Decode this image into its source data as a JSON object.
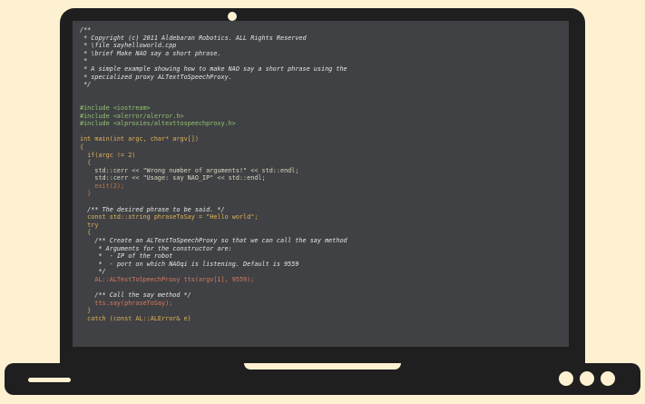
{
  "code_lines": [
    {
      "cls": "c",
      "text": "/**"
    },
    {
      "cls": "c",
      "text": " * Copyright (c) 2011 Aldebaran Robotics. ALL Rights Reserved"
    },
    {
      "cls": "c",
      "text": " * \\file sayhelloworld.cpp"
    },
    {
      "cls": "c",
      "text": " * \\brief Make NAO say a short phrase."
    },
    {
      "cls": "c",
      "text": " *"
    },
    {
      "cls": "c",
      "text": " * A simple example showing how to make NAO say a short phrase using the"
    },
    {
      "cls": "c",
      "text": " * specialized proxy ALTextToSpeechProxy."
    },
    {
      "cls": "c",
      "text": " */"
    },
    {
      "cls": "tx",
      "text": ""
    },
    {
      "cls": "tx",
      "text": ""
    },
    {
      "cls": "pp",
      "text": "#include <iostream>"
    },
    {
      "cls": "pp",
      "text": "#include <alerror/alerror.h>"
    },
    {
      "cls": "pp",
      "text": "#include <alproxies/altexttospeechproxy.h>"
    },
    {
      "cls": "tx",
      "text": ""
    },
    {
      "cls": "kw",
      "text": "int main(int argc, char* argv[])"
    },
    {
      "cls": "kw",
      "text": "{"
    },
    {
      "cls": "kw",
      "text": "  if(argc != 2)"
    },
    {
      "cls": "kw",
      "text": "  {"
    },
    {
      "cls": "st",
      "text": "    std::cerr << \"Wrong number of arguments!\" << std::endl;"
    },
    {
      "cls": "st",
      "text": "    std::cerr << \"Usage: say NAO_IP\" << std::endl;"
    },
    {
      "cls": "fn",
      "text": "    exit(2);"
    },
    {
      "cls": "fn",
      "text": "  }"
    },
    {
      "cls": "tx",
      "text": ""
    },
    {
      "cls": "c",
      "text": "  /** The desired phrase to be said. */"
    },
    {
      "cls": "kw",
      "text": "  const std::string phraseToSay = \"Hello world\";"
    },
    {
      "cls": "kw",
      "text": "  try"
    },
    {
      "cls": "kw",
      "text": "  {"
    },
    {
      "cls": "c",
      "text": "    /** Create an ALTextToSpeechProxy so that we can call the say method"
    },
    {
      "cls": "c",
      "text": "     * Arguments for the constructor are:"
    },
    {
      "cls": "c",
      "text": "     *  - IP of the robot"
    },
    {
      "cls": "c",
      "text": "     *  - port on which NAOqi is listening. Default is 9559"
    },
    {
      "cls": "c",
      "text": "     */"
    },
    {
      "cls": "ty",
      "text": "    AL::ALTextToSpeechProxy tts(argv[1], 9559);"
    },
    {
      "cls": "tx",
      "text": ""
    },
    {
      "cls": "c",
      "text": "    /** Call the say method */"
    },
    {
      "cls": "ty",
      "text": "    tts.say(phraseToSay);"
    },
    {
      "cls": "kw",
      "text": "  }"
    },
    {
      "cls": "kw",
      "text": "  catch (const AL::ALError& e)"
    }
  ]
}
